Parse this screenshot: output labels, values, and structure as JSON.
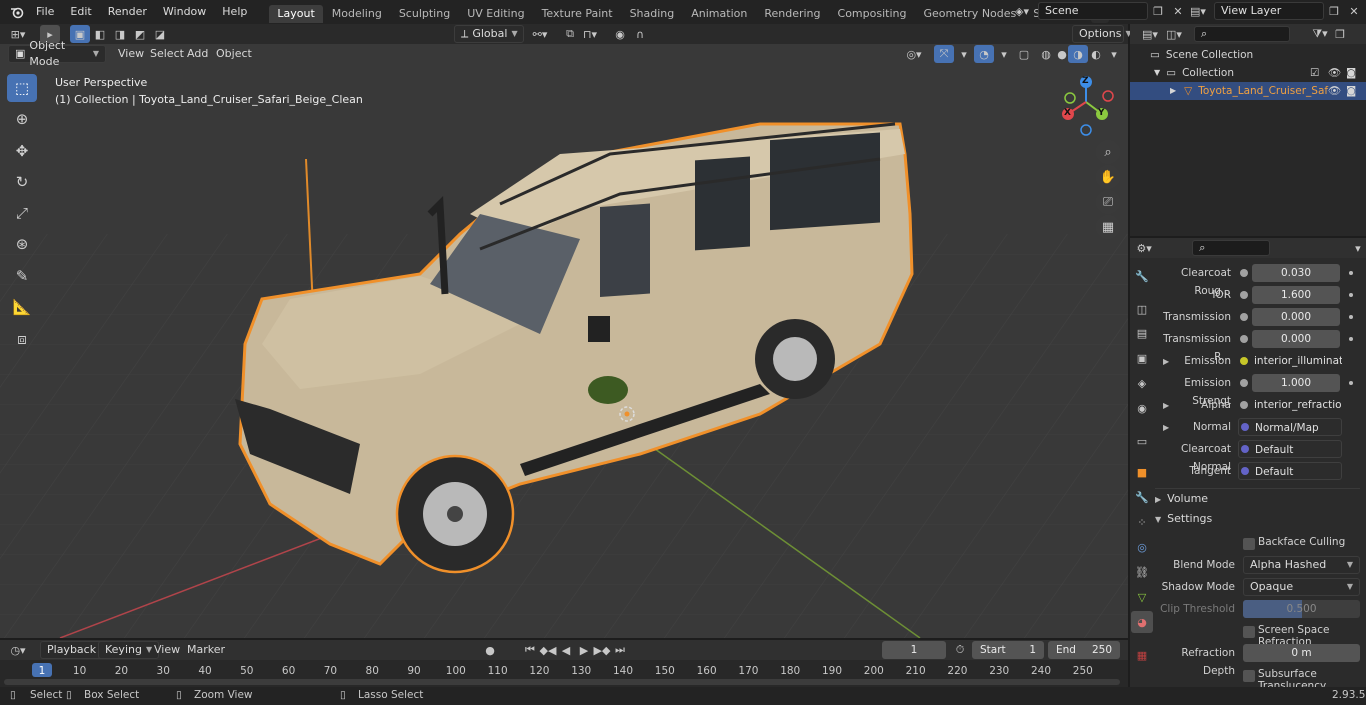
{
  "menubar": {
    "items": [
      "File",
      "Edit",
      "Render",
      "Window",
      "Help"
    ],
    "workspaces": [
      "Layout",
      "Modeling",
      "Sculpting",
      "UV Editing",
      "Texture Paint",
      "Shading",
      "Animation",
      "Rendering",
      "Compositing",
      "Geometry Nodes",
      "Scripting"
    ],
    "active_workspace": "Layout",
    "scene_name": "Scene",
    "view_layer": "View Layer"
  },
  "viewport_header": {
    "mode": "Object Mode",
    "menus": [
      "View",
      "Select",
      "Add",
      "Object"
    ],
    "transform_orientation": "Global",
    "options_label": "Options"
  },
  "viewport": {
    "perspective_label": "User Perspective",
    "collection_label": "(1) Collection | Toyota_Land_Cruiser_Safari_Beige_Clean",
    "gizmo": {
      "x": "X",
      "y": "Y",
      "z": "Z"
    }
  },
  "outliner": {
    "scene_collection": "Scene Collection",
    "collection": "Collection",
    "object": "Toyota_Land_Cruiser_Saf"
  },
  "properties": {
    "rows": [
      {
        "label": "Clearcoat Roug...",
        "value": "0.030",
        "type": "value"
      },
      {
        "label": "IOR",
        "value": "1.600",
        "type": "value"
      },
      {
        "label": "Transmission",
        "value": "0.000",
        "type": "value"
      },
      {
        "label": "Transmission R...",
        "value": "0.000",
        "type": "value"
      },
      {
        "label": "Emission",
        "value": "interior_illumination...",
        "type": "link-color"
      },
      {
        "label": "Emission Strengt",
        "value": "1.000",
        "type": "value"
      },
      {
        "label": "Alpha",
        "value": "interior_refraction_in...",
        "type": "link-color"
      },
      {
        "label": "Normal",
        "value": "Normal/Map",
        "type": "link-vector"
      },
      {
        "label": "Clearcoat Normal",
        "value": "Default",
        "type": "link-vector"
      },
      {
        "label": "Tangent",
        "value": "Default",
        "type": "link-vector"
      }
    ],
    "volume_label": "Volume",
    "settings_label": "Settings",
    "backface_culling": "Backface Culling",
    "blend_mode_label": "Blend Mode",
    "blend_mode": "Alpha Hashed",
    "shadow_mode_label": "Shadow Mode",
    "shadow_mode": "Opaque",
    "clip_threshold_label": "Clip Threshold",
    "clip_threshold": "0.500",
    "screen_space_refraction": "Screen Space Refraction",
    "refraction_depth_label": "Refraction Depth",
    "refraction_depth": "0 m",
    "subsurface_translucency": "Subsurface Translucency"
  },
  "timeline": {
    "menus": [
      "Playback",
      "Keying",
      "View",
      "Marker"
    ],
    "current_frame": "1",
    "start_label": "Start",
    "start": "1",
    "end_label": "End",
    "end": "250",
    "ticks": [
      "1",
      "10",
      "20",
      "30",
      "40",
      "50",
      "60",
      "70",
      "80",
      "90",
      "100",
      "110",
      "120",
      "130",
      "140",
      "150",
      "160",
      "170",
      "180",
      "190",
      "200",
      "210",
      "220",
      "230",
      "240",
      "250"
    ]
  },
  "statusbar": {
    "select": "Select",
    "box_select": "Box Select",
    "zoom_view": "Zoom View",
    "lasso_select": "Lasso Select",
    "version": "2.93.5"
  },
  "colors": {
    "accent": "#4772b3",
    "selection_outline": "#f0902a",
    "x_axis": "#e0474c",
    "y_axis": "#8bc93f",
    "z_axis": "#3d8ee8"
  }
}
